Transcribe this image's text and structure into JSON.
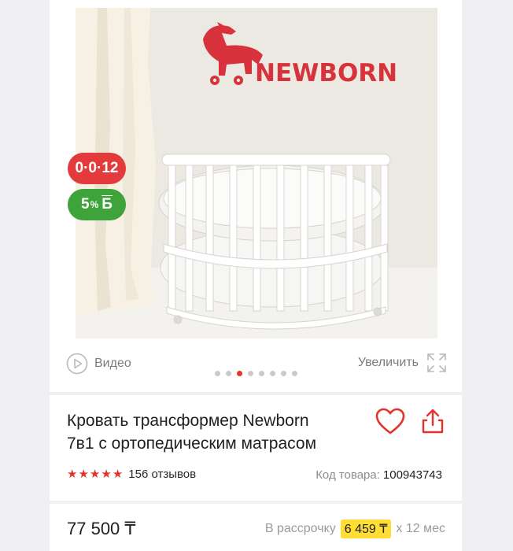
{
  "badges": {
    "installment": "0·0·12",
    "bonus_percent": "5",
    "bonus_percent_sign": "%",
    "bonus_currency": "Б"
  },
  "photo": {
    "logo_text": "NEWBORN"
  },
  "media": {
    "video_label": "Видео",
    "zoom_label": "Увеличить",
    "slides_total": 8,
    "slide_active": 3
  },
  "product": {
    "title_line1": "Кровать трансформер Newborn",
    "title_line2": "7в1 с ортопедическим матрасом",
    "rating_stars": 5,
    "reviews_label": "156 отзывов",
    "sku_label": "Код товара:",
    "sku_value": "100943743"
  },
  "pricing": {
    "price": "77 500 ₸",
    "installment_prefix": "В рассрочку",
    "installment_amount": "6 459 ₸",
    "installment_suffix": "x 12 мес"
  },
  "colors": {
    "accent_red": "#e6332a",
    "bonus_green": "#3fa33b",
    "installment_yellow": "#ffdd33"
  }
}
